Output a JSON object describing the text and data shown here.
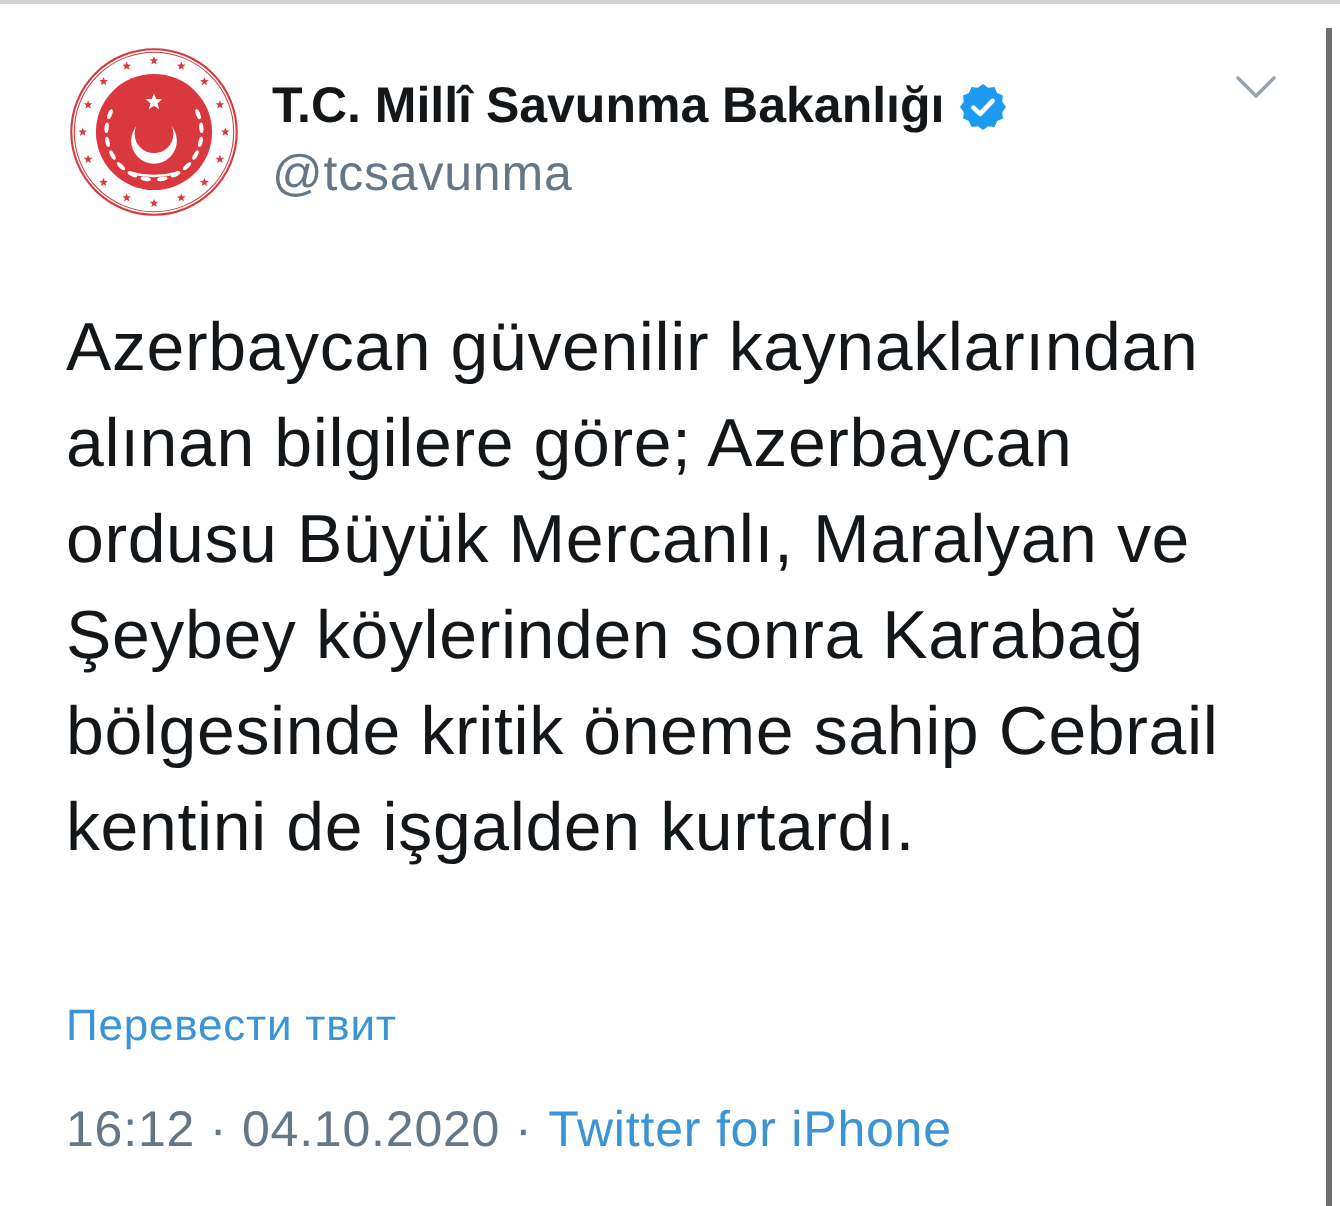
{
  "tweet": {
    "author": {
      "name": "T.C. Millî Savunma Bakanlığı",
      "verified": true,
      "handle": "@tcsavunma"
    },
    "text": "Azerbaycan güvenilir kaynaklarından alınan bilgilere göre; Azerbaycan ordusu Büyük Mercanlı, Maralyan ve Şeybey köylerinden sonra Karabağ bölgesinde kritik öneme sahip Cebrail kentini de işgalden kurtardı.",
    "translate_link": "Перевести твит",
    "meta": "16:12 · 04.10.2020 ·",
    "source": "Twitter for iPhone"
  }
}
